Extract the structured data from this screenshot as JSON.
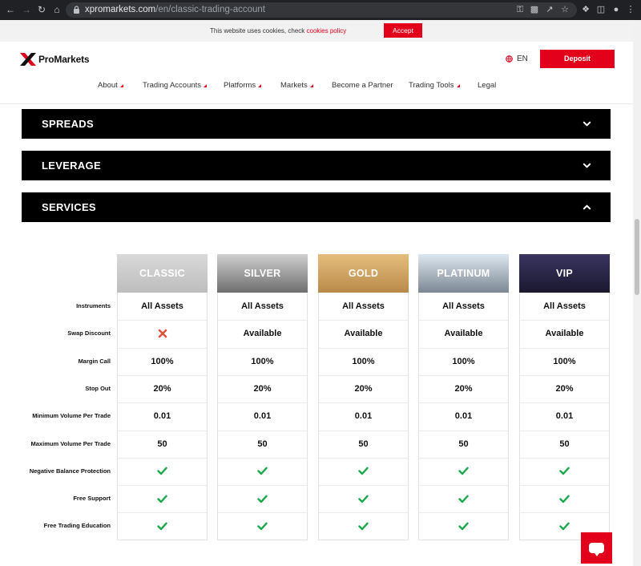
{
  "browser": {
    "url_host": "xpromarkets.com",
    "url_path": "/en/classic-trading-account"
  },
  "cookie_bar": {
    "message": "This website uses cookies, check ",
    "link": "cookies policy",
    "accept": "Accept"
  },
  "header": {
    "logo_text": "ProMarkets",
    "language": "EN",
    "deposit": "Deposit",
    "nav": [
      {
        "label": "About",
        "dropdown": true
      },
      {
        "label": "Trading Accounts",
        "dropdown": true
      },
      {
        "label": "Platforms",
        "dropdown": true
      },
      {
        "label": "Markets",
        "dropdown": true
      },
      {
        "label": "Become a Partner",
        "dropdown": false
      },
      {
        "label": "Trading Tools",
        "dropdown": true
      },
      {
        "label": "Legal",
        "dropdown": false
      }
    ]
  },
  "accordions": [
    {
      "label": "SPREADS",
      "state": "collapsed"
    },
    {
      "label": "LEVERAGE",
      "state": "collapsed"
    },
    {
      "label": "SERVICES",
      "state": "expanded"
    }
  ],
  "services_table": {
    "accounts": [
      {
        "name": "CLASSIC",
        "color_top": "#d9d9d9",
        "color_bottom": "#bdbdbd"
      },
      {
        "name": "SILVER",
        "color_top": "#cfcfcf",
        "color_bottom": "#6e6e6e"
      },
      {
        "name": "GOLD",
        "color_top": "#e6bd7c",
        "color_bottom": "#b88a4a"
      },
      {
        "name": "PLATINUM",
        "color_top": "#dde7ef",
        "color_bottom": "#7b8894"
      },
      {
        "name": "VIP",
        "color_top": "#3a3560",
        "color_bottom": "#1b1830"
      }
    ],
    "rows": [
      {
        "label": "Instruments",
        "values": [
          "All Assets",
          "All Assets",
          "All Assets",
          "All Assets",
          "All Assets"
        ]
      },
      {
        "label": "Swap Discount",
        "values": [
          "cross-icon",
          "Available",
          "Available",
          "Available",
          "Available"
        ]
      },
      {
        "label": "Margin Call",
        "values": [
          "100%",
          "100%",
          "100%",
          "100%",
          "100%"
        ]
      },
      {
        "label": "Stop Out",
        "values": [
          "20%",
          "20%",
          "20%",
          "20%",
          "20%"
        ]
      },
      {
        "label": "Minimum Volume Per Trade",
        "values": [
          "0.01",
          "0.01",
          "0.01",
          "0.01",
          "0.01"
        ]
      },
      {
        "label": "Maximum Volume Per Trade",
        "values": [
          "50",
          "50",
          "50",
          "50",
          "50"
        ]
      },
      {
        "label": "Negative Balance Protection",
        "values": [
          "check-icon",
          "check-icon",
          "check-icon",
          "check-icon",
          "check-icon"
        ]
      },
      {
        "label": "Free Support",
        "values": [
          "check-icon",
          "check-icon",
          "check-icon",
          "check-icon",
          "check-icon"
        ]
      },
      {
        "label": "Free Trading Education",
        "values": [
          "check-icon",
          "check-icon",
          "check-icon",
          "check-icon",
          "check-icon"
        ]
      }
    ]
  },
  "colors": {
    "brand_red": "#e3001b",
    "check_green": "#1aa84a",
    "cross_red": "#e0533d"
  }
}
